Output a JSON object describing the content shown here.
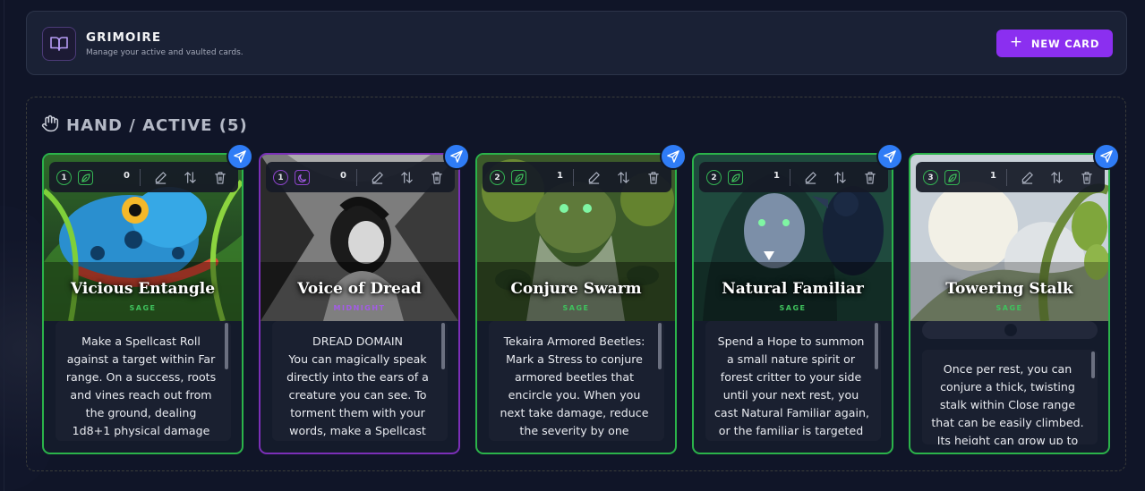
{
  "header": {
    "title": "GRIMOIRE",
    "subtitle": "Manage your active and vaulted cards.",
    "new_card_label": "NEW CARD",
    "icon": "book-open-icon"
  },
  "section": {
    "title": "HAND / ACTIVE (5)",
    "icon": "hand-icon"
  },
  "colors": {
    "accent_purple": "#8b2ff0",
    "sage_green": "#2bb34a",
    "midnight_purple": "#7b2fb8",
    "send_blue": "#2f7cf6"
  },
  "cards": [
    {
      "name": "Vicious Entangle",
      "domain": "SAGE",
      "level": "1",
      "recall": "0",
      "text_lines": [
        "Make a Spellcast Roll",
        "against a target within Far",
        "range. On a success, roots",
        "and vines reach out from",
        "the ground, dealing",
        "1d8+1 physical damage"
      ]
    },
    {
      "name": "Voice of Dread",
      "domain": "MIDNIGHT",
      "level": "1",
      "recall": "0",
      "text_lines": [
        "DREAD DOMAIN",
        "You can magically speak",
        "directly into the ears of a",
        "creature you can see. To",
        "torment them with your",
        "words, make a Spellcast"
      ]
    },
    {
      "name": "Conjure Swarm",
      "domain": "SAGE",
      "level": "2",
      "recall": "1",
      "text_lines": [
        "Tekaira Armored Beetles:",
        "Mark a Stress to conjure",
        "armored beetles that",
        "encircle you. When you",
        "next take damage, reduce",
        "the severity by one"
      ]
    },
    {
      "name": "Natural Familiar",
      "domain": "SAGE",
      "level": "2",
      "recall": "1",
      "text_lines": [
        "Spend a Hope to summon",
        "a small nature spirit or",
        "forest critter to your side",
        "until your next rest, you",
        "cast Natural Familiar again,",
        "or the familiar is targeted"
      ]
    },
    {
      "name": "Towering Stalk",
      "domain": "SAGE",
      "level": "3",
      "recall": "1",
      "text_lines": [
        "Once per rest, you can",
        "conjure a thick, twisting",
        "stalk within Close range",
        "that can be easily climbed.",
        "Its height can grow up to"
      ]
    }
  ]
}
